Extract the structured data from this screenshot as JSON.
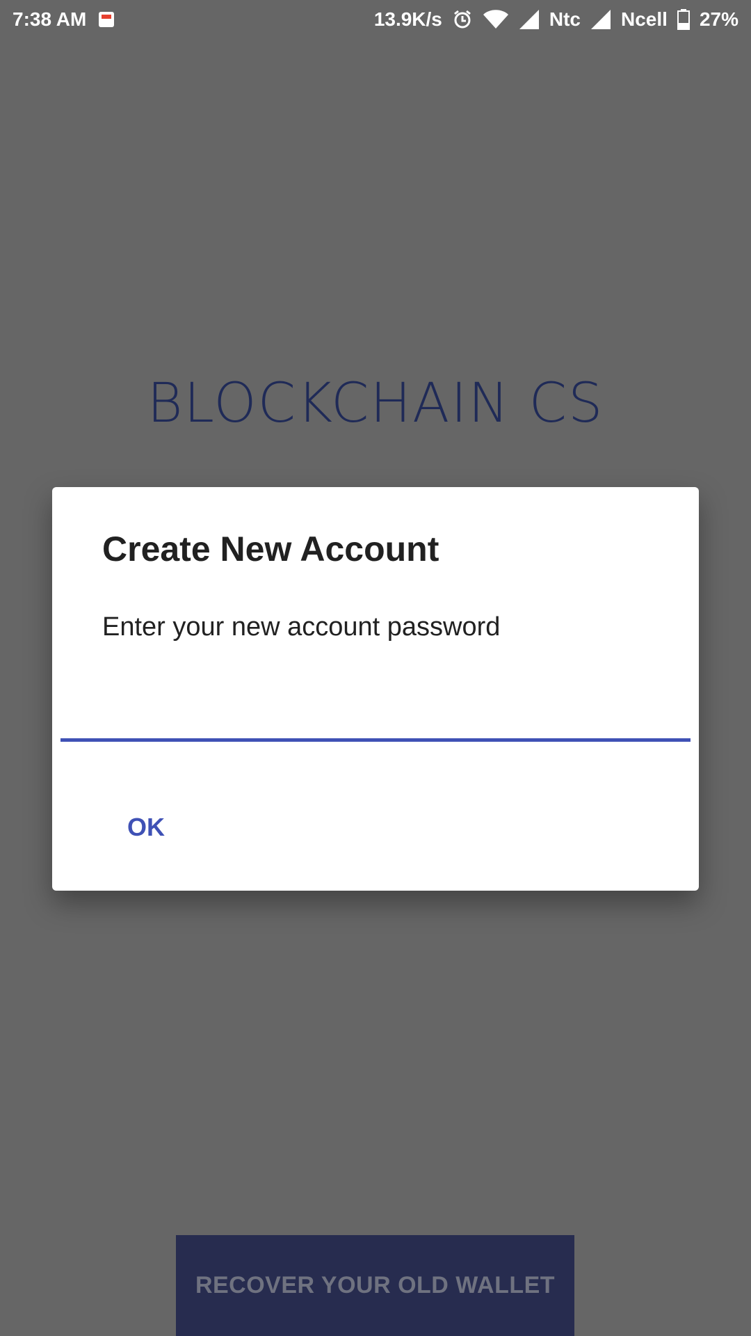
{
  "statusbar": {
    "time": "7:38 AM",
    "speed": "13.9K/s",
    "carrier1": "Ntc",
    "carrier2": "Ncell",
    "battery": "27%"
  },
  "app": {
    "title": "BLOCKCHAIN CS",
    "recover_label": "RECOVER YOUR OLD WALLET"
  },
  "dialog": {
    "title": "Create New Account",
    "message": "Enter your new account password",
    "input_value": "",
    "ok_label": "OK"
  },
  "colors": {
    "accent": "#3f51b5",
    "overlay": "#666666"
  }
}
